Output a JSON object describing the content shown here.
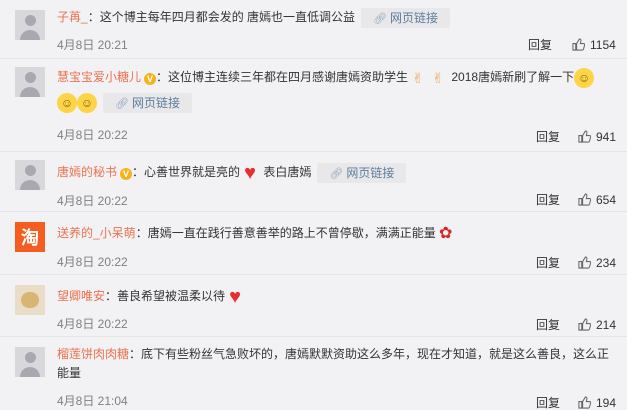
{
  "comments": [
    {
      "user": "子苒_",
      "text1": "：这个博主每年四月都会发的 唐嫣也一直低调公益",
      "link_label": "网页链接",
      "date": "4月8日 20:21",
      "reply": "回复",
      "likes": "1154"
    },
    {
      "user": "慧宝宝爱小糖儿",
      "text1": "：这位博主连续三年都在四月感谢唐嫣资助学生",
      "text2": "2018唐嫣新刷了解一下",
      "link_label": "网页链接",
      "date": "4月8日 20:22",
      "reply": "回复",
      "likes": "941"
    },
    {
      "user": "唐嫣的秘书",
      "text1": "：心善世界就是亮的",
      "text2": "表白唐嫣",
      "link_label": "网页链接",
      "date": "4月8日 20:22",
      "reply": "回复",
      "likes": "654"
    },
    {
      "user": "送养的_小呆萌",
      "text1": "：唐嫣一直在践行善意善举的路上不曾停歇，满满正能量",
      "avatar_glyph": "淘",
      "date": "4月8日 20:22",
      "reply": "回复",
      "likes": "234"
    },
    {
      "user": "望卿唯安",
      "text1": "：善良希望被温柔以待",
      "date": "4月8日 20:22",
      "reply": "回复",
      "likes": "214"
    },
    {
      "user": "榴莲饼肉肉糖",
      "text1": "：底下有些粉丝气急败坏的，唐嫣默默资助这么多年，现在才知道，就是这么善良，这么正",
      "text2": "能量",
      "date": "4月8日 21:04",
      "reply": "回复",
      "likes": "194"
    }
  ],
  "icons": {
    "link": "link-icon",
    "like": "thumbs-up-icon",
    "verified": "verified-v-badge",
    "emoji_grin": "grin-emoji",
    "emoji_heart": "heart-emoji",
    "emoji_clap": "clapping-hands-emoji",
    "emoji_rose": "rose-emoji"
  },
  "colors": {
    "username": "#eb7350",
    "background": "#f2f2f5",
    "link_text": "#5d7d9b",
    "date": "#808080"
  }
}
